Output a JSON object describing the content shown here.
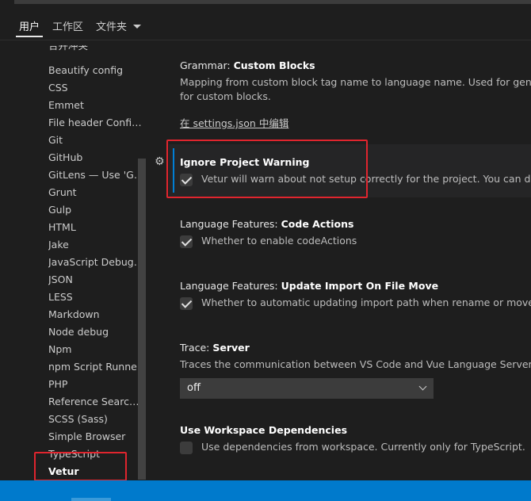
{
  "tabs": [
    {
      "label": "用户",
      "active": true
    },
    {
      "label": "工作区"
    },
    {
      "label": "文件夹"
    }
  ],
  "toc": {
    "items": [
      "合并冲突",
      "Beautify config",
      "CSS",
      "Emmet",
      "File header Configu...",
      "Git",
      "GitHub",
      "GitLens — Use 'Git...",
      "Grunt",
      "Gulp",
      "HTML",
      "Jake",
      "JavaScript Debugger",
      "JSON",
      "LESS",
      "Markdown",
      "Node debug",
      "Npm",
      "npm Script Runner",
      "PHP",
      "Reference Search V...",
      "SCSS (Sass)",
      "Simple Browser",
      "TypeScript",
      "Vetur"
    ],
    "active": "Vetur"
  },
  "settings": {
    "custom_blocks": {
      "category": "Grammar: ",
      "name": "Custom Blocks",
      "desc1": "Mapping from custom block tag name to language name. Used for generating",
      "desc2": "for custom blocks.",
      "link": "在 settings.json 中编辑"
    },
    "ignore_warning": {
      "name": "Ignore Project Warning",
      "desc": "Vetur will warn about not setup correctly for the project. You can disable",
      "checked": true
    },
    "code_actions": {
      "category": "Language Features: ",
      "name": "Code Actions",
      "desc": "Whether to enable codeActions",
      "checked": true
    },
    "update_import": {
      "category": "Language Features: ",
      "name": "Update Import On File Move",
      "desc": "Whether to automatic updating import path when rename or move a file",
      "checked": true
    },
    "trace_server": {
      "category": "Trace: ",
      "name": "Server",
      "desc": "Traces the communication between VS Code and Vue Language Server.",
      "value": "off"
    },
    "workspace_deps": {
      "name": "Use Workspace Dependencies",
      "desc": "Use dependencies from workspace. Currently only for TypeScript.",
      "checked": false
    }
  },
  "colors": {
    "accent": "#007acc",
    "highlight": "#e0252e"
  }
}
